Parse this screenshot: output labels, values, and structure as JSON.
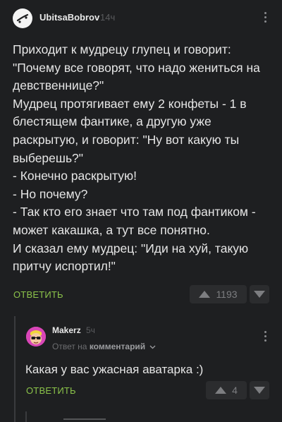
{
  "comment": {
    "author": "UbitsaBobrov",
    "time": "14ч",
    "lines": [
      "Приходит к мудрецу глупец и говорит:",
      "\"Почему все говорят, что надо жениться на девственнице?\"",
      "Мудрец протягивает ему 2 конфеты - 1 в блестящем фантике, а другую уже раскрытую, и говорит: \"Ну вот какую ты выберешь?\"",
      "- Конечно раскрытую!",
      "- Но почему?",
      "- Так кто его знает что там под фантиком - может какашка, а тут все понятно.",
      "И сказал ему мудрец: \"Иди на хуй, такую притчу испортил!\""
    ],
    "reply_label": "ОТВЕТИТЬ",
    "rating": "1193"
  },
  "reply": {
    "author": "Makerz",
    "time": "5ч",
    "reply_to_prefix": "Ответ на",
    "reply_to_target": "комментарий",
    "text": "Какая у вас ужасная аватарка :)",
    "reply_label": "ОТВЕТИТЬ",
    "rating": "4"
  },
  "icons": {
    "avatar1": "skateboard-logo-avatar",
    "avatar2": "cartoon-face-avatar",
    "more": "vertical-dots-icon",
    "upvote": "triangle-up-icon",
    "downvote": "triangle-down-icon",
    "chevron": "chevron-down-icon"
  },
  "colors": {
    "background": "#1e1f21",
    "accent": "#8bc34a",
    "avatar2_bg": "#d946b7"
  }
}
